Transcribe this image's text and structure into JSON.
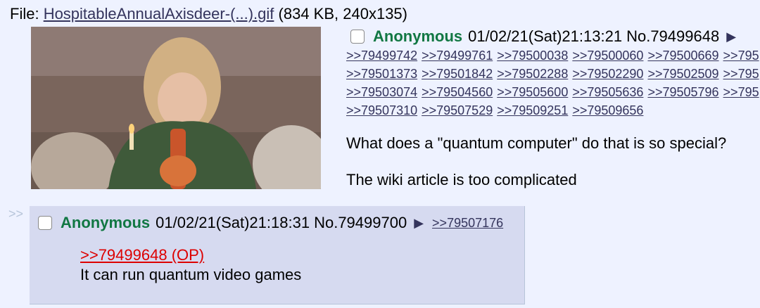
{
  "file": {
    "label": "File:",
    "filename": "HospitableAnnualAxisdeer-(...).gif",
    "meta": "(834 KB, 240x135)"
  },
  "op": {
    "name": "Anonymous",
    "datetime": "01/02/21(Sat)21:13:21",
    "post_no": "No.79499648",
    "menu_arrow": "▶",
    "backlink_rows": [
      [
        ">>79499742",
        ">>79499761",
        ">>79500038",
        ">>79500060",
        ">>79500669",
        ">>795"
      ],
      [
        ">>79501373",
        ">>79501842",
        ">>79502288",
        ">>79502290",
        ">>79502509",
        ">>795"
      ],
      [
        ">>79503074",
        ">>79504560",
        ">>79505600",
        ">>79505636",
        ">>79505796",
        ">>795"
      ],
      [
        ">>79507310",
        ">>79507529",
        ">>79509251",
        ">>79509656"
      ]
    ],
    "message": [
      "What does a \"quantum computer\" do that is so special?",
      "The wiki article is too complicated"
    ]
  },
  "reply": {
    "side_arrows": ">>",
    "name": "Anonymous",
    "datetime": "01/02/21(Sat)21:18:31",
    "post_no": "No.79499700",
    "menu_arrow": "▶",
    "backlink": ">>79507176",
    "quote": ">>79499648 (OP)",
    "text": "It can run quantum video games"
  },
  "colors": {
    "background": "#eef2ff",
    "reply_bg": "#d6daf0",
    "name": "#117743",
    "link": "#34345c",
    "quotelink": "#dd0000"
  }
}
